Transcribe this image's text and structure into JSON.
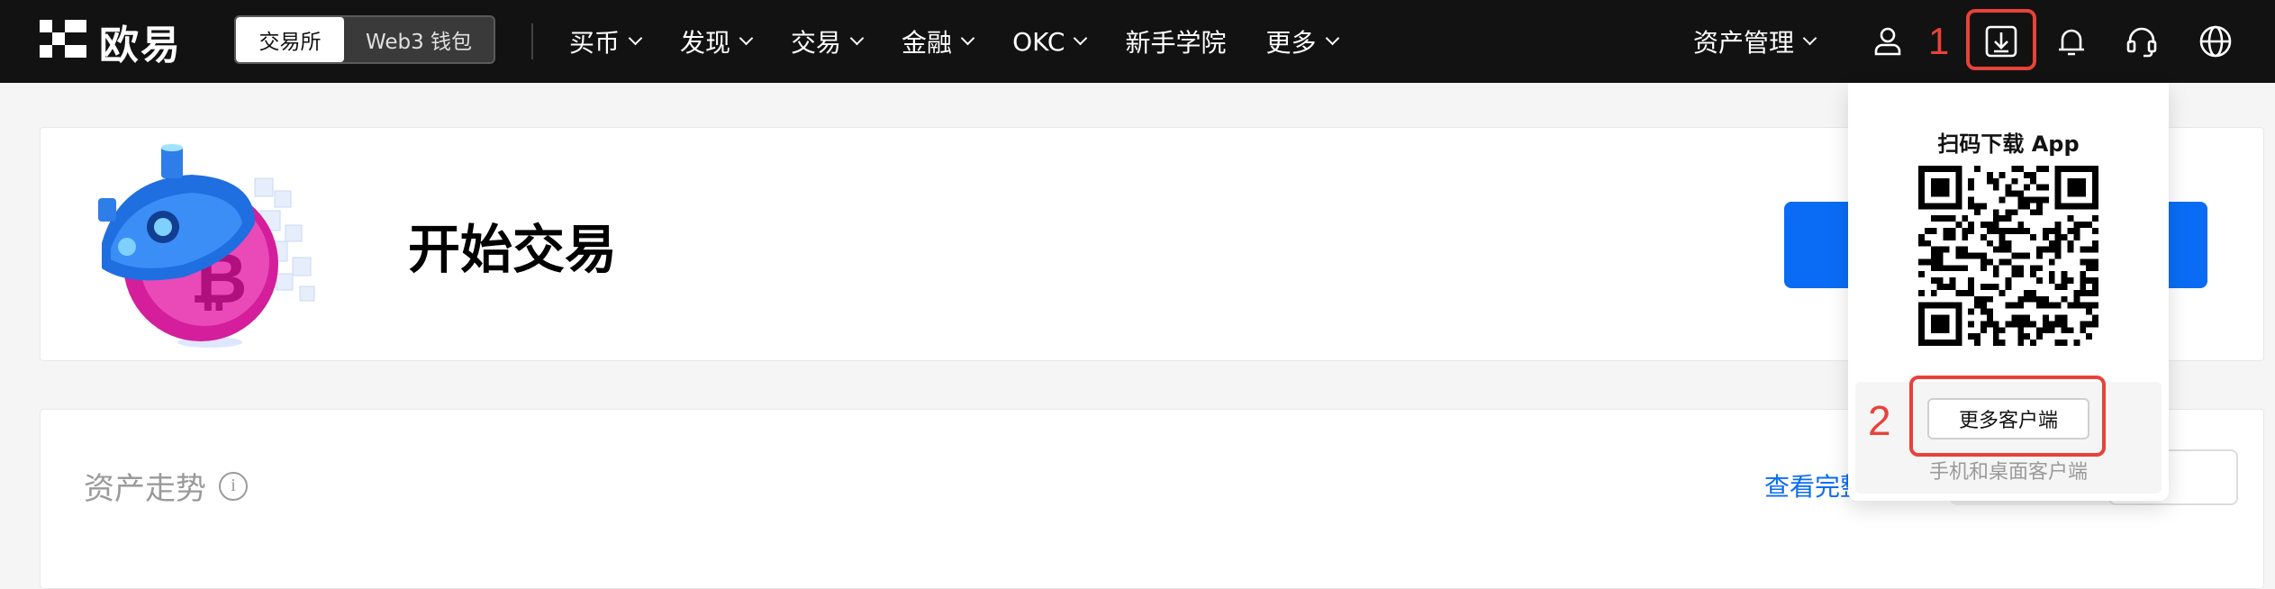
{
  "navbar": {
    "logo_text": "欧易",
    "segment": {
      "exchange": "交易所",
      "wallet": "Web3 钱包"
    },
    "menu": [
      {
        "label": "买币",
        "has_dropdown": true
      },
      {
        "label": "发现",
        "has_dropdown": true
      },
      {
        "label": "交易",
        "has_dropdown": true
      },
      {
        "label": "金融",
        "has_dropdown": true
      },
      {
        "label": "OKC",
        "has_dropdown": true
      },
      {
        "label": "新手学院",
        "has_dropdown": false
      },
      {
        "label": "更多",
        "has_dropdown": true
      }
    ],
    "asset_management": "资产管理",
    "icons": [
      "user-icon",
      "download-icon",
      "bell-icon",
      "headset-icon",
      "globe-icon"
    ]
  },
  "annotations": {
    "mark_1": "1",
    "mark_2": "2",
    "color": "#e8423a"
  },
  "card_start": {
    "title": "开始交易"
  },
  "card_assets": {
    "title": "资产走势",
    "info_icon_glyph": "i",
    "view_link": "查看完整"
  },
  "download_popup": {
    "title": "扫码下载 App",
    "more_clients_button": "更多客户端",
    "subtitle": "手机和桌面客户端"
  },
  "colors": {
    "nav_bg": "#121212",
    "accent_blue": "#0a6cf5",
    "highlight_red": "#e8423a"
  }
}
